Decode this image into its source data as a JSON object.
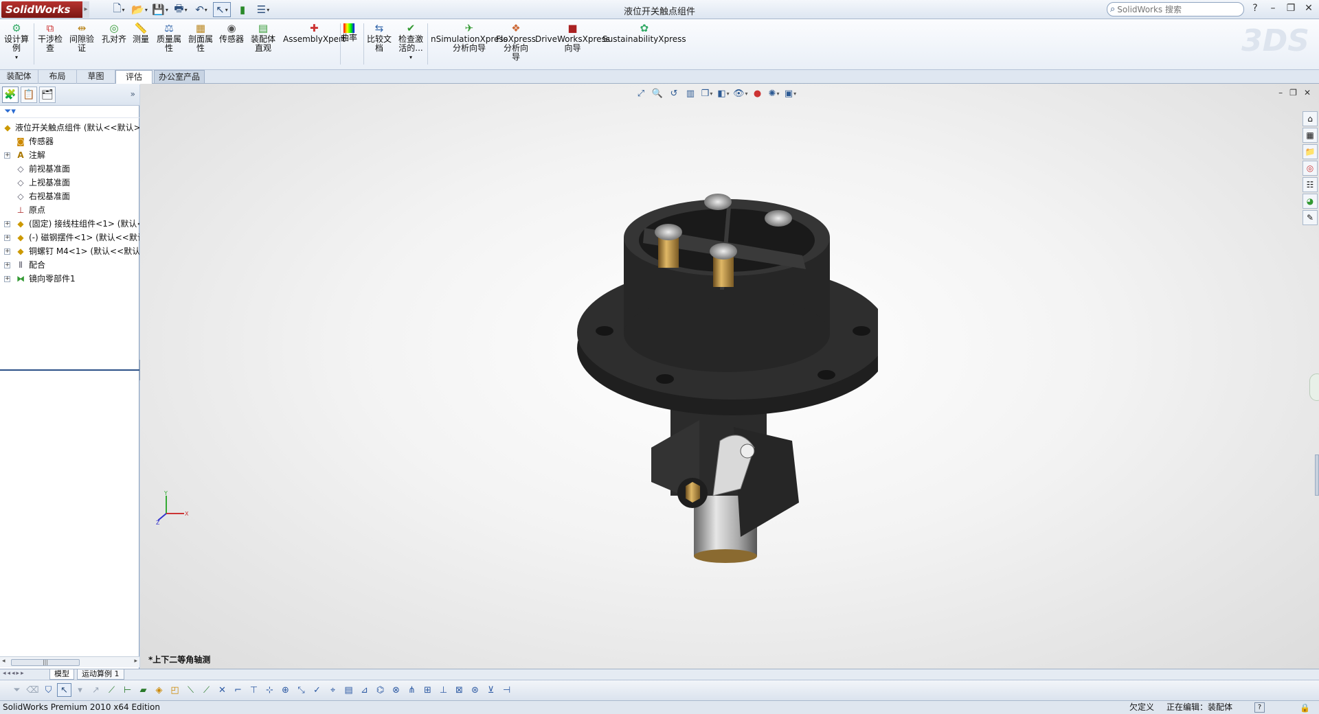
{
  "app": {
    "logo_text": "SolidWorks",
    "document_title": "液位开关触点组件",
    "search_placeholder": "SolidWorks 搜索",
    "help_glyph": "?"
  },
  "ribbon": {
    "buttons": [
      {
        "label": "设计算\n例",
        "icon": "design-study-icon"
      },
      {
        "label": "干涉检\n查",
        "icon": "interference-icon"
      },
      {
        "label": "间隙验\n证",
        "icon": "clearance-icon"
      },
      {
        "label": "孔对齐",
        "icon": "hole-align-icon"
      },
      {
        "label": "测量",
        "icon": "measure-icon"
      },
      {
        "label": "质量属\n性",
        "icon": "mass-props-icon"
      },
      {
        "label": "剖面属\n性",
        "icon": "section-props-icon"
      },
      {
        "label": "传感器",
        "icon": "sensor-icon"
      },
      {
        "label": "装配体\n直观",
        "icon": "assembly-visual-icon"
      },
      {
        "label": "AssemblyXpert",
        "icon": "assemblyxpert-icon"
      },
      {
        "label": "曲率",
        "icon": "curvature-icon"
      },
      {
        "label": "比较文\n档",
        "icon": "compare-icon"
      },
      {
        "label": "检查激\n活的...",
        "icon": "check-icon"
      },
      {
        "label": "nSimulationXpress\n分析向导",
        "icon": "simxpress-icon"
      },
      {
        "label": "FloXpress\n分析向\n导",
        "icon": "floxpress-icon"
      },
      {
        "label": "DriveWorksXpress\n向导",
        "icon": "driveworks-icon"
      },
      {
        "label": "SustainabilityXpress",
        "icon": "sustainability-icon"
      }
    ]
  },
  "tabs": [
    "装配体",
    "布局",
    "草图",
    "评估",
    "办公室产品"
  ],
  "tree": {
    "root": "液位开关触点组件 (默认<<默认>",
    "items": [
      {
        "label": "传感器",
        "icon": "sensor-folder-icon",
        "expandable": false
      },
      {
        "label": "注解",
        "icon": "annotation-icon",
        "expandable": true
      },
      {
        "label": "前视基准面",
        "icon": "plane-icon",
        "expandable": false
      },
      {
        "label": "上视基准面",
        "icon": "plane-icon",
        "expandable": false
      },
      {
        "label": "右视基准面",
        "icon": "plane-icon",
        "expandable": false
      },
      {
        "label": "原点",
        "icon": "origin-icon",
        "expandable": false
      },
      {
        "label": "(固定) 接线柱组件<1> (默认<",
        "icon": "subassembly-icon",
        "expandable": true
      },
      {
        "label": "(-) 磁钢摆件<1> (默认<<默认",
        "icon": "subassembly-icon",
        "expandable": true
      },
      {
        "label": "铜螺钉 M4<1> (默认<<默认",
        "icon": "subassembly-icon",
        "expandable": true
      },
      {
        "label": "配合",
        "icon": "mates-icon",
        "expandable": true
      },
      {
        "label": "镜向零部件1",
        "icon": "mirror-icon",
        "expandable": true
      }
    ]
  },
  "viewport": {
    "view_name": "*上下二等角轴测",
    "triad": {
      "x": "X",
      "y": "Y",
      "z": "Z"
    }
  },
  "model_tabs": [
    "模型",
    "运动算例 1"
  ],
  "status": {
    "app_name": "SolidWorks Premium 2010 x64 Edition",
    "definition": "欠定义",
    "editing": "正在编辑：装配体"
  },
  "colors": {
    "accent": "#2a4f86",
    "model_body": "#2b2b2b",
    "brass": "#b8893a"
  }
}
